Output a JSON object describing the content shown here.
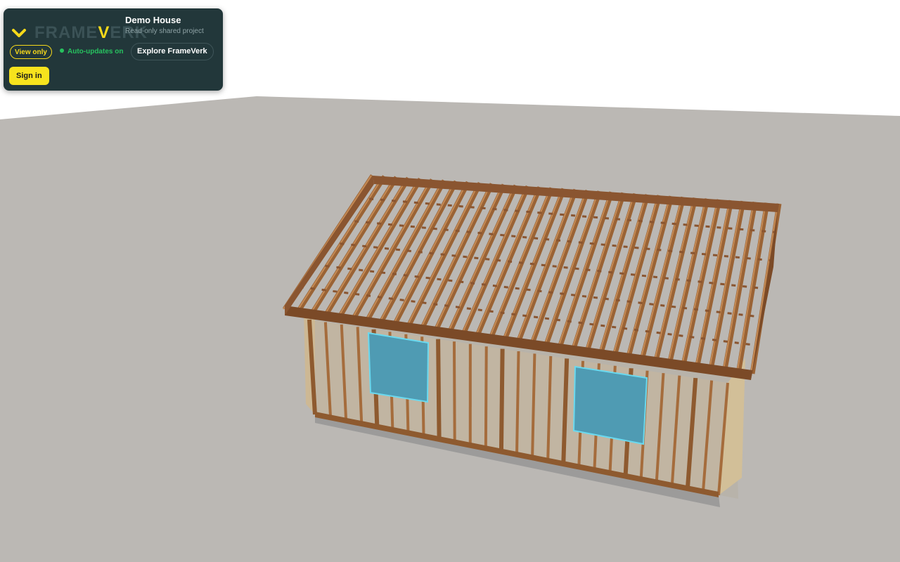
{
  "app": {
    "logo_text_prefix": "FRAME",
    "logo_text_accent": "V",
    "logo_text_suffix": "ERK",
    "brand_color": "#f7d91a",
    "panel_color": "#22373a"
  },
  "project": {
    "title": "Demo House",
    "subtitle": "Read-only shared project"
  },
  "status": {
    "view_only_label": "View only",
    "auto_updates_label": "Auto-updates on",
    "auto_updates_color": "#27c25f"
  },
  "actions": {
    "explore_label": "Explore FrameVerk",
    "sign_in_label": "Sign in"
  },
  "scene": {
    "background_color": "#ffffff",
    "ground_color": "#bbb8b4",
    "lumber_color": "#a56c3c",
    "window_color": "#4f9bb3",
    "sheathing_color": "#c9b393"
  },
  "icons": {
    "panel_toggle": "chevron-down-icon",
    "status_indicator": "status-dot-icon"
  }
}
